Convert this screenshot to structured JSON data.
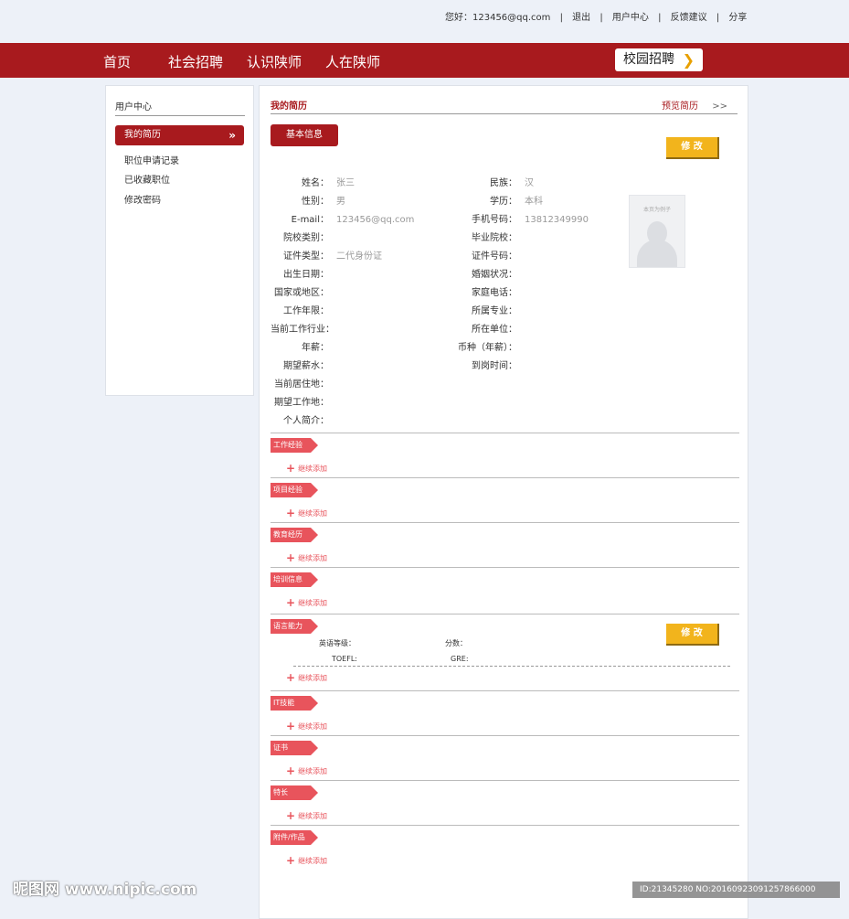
{
  "topbar": {
    "greeting": "您好：123456@qq.com",
    "links": [
      "退出",
      "用户中心",
      "反馈建议",
      "分享"
    ]
  },
  "nav": {
    "items": [
      "首页",
      "社会招聘",
      "认识陕师",
      "人在陕师"
    ],
    "campus": "校园招聘"
  },
  "sidebar": {
    "title": "用户中心",
    "active": "我的简历",
    "links": [
      "职位申请记录",
      "已收藏职位",
      "修改密码"
    ]
  },
  "main": {
    "title": "我的简历",
    "preview": "预览简历",
    "preview_arrow": ">>",
    "basic_info": "基本信息",
    "edit_label": "修 改",
    "photo_text": "本页为例子",
    "fields_left": [
      {
        "label": "姓名：",
        "value": "张三"
      },
      {
        "label": "性别：",
        "value": "男"
      },
      {
        "label": "E-mail：",
        "value": "123456@qq.com"
      },
      {
        "label": "院校类别：",
        "value": ""
      },
      {
        "label": "证件类型：",
        "value": "二代身份证"
      },
      {
        "label": "出生日期：",
        "value": ""
      },
      {
        "label": "国家或地区：",
        "value": ""
      },
      {
        "label": "工作年限：",
        "value": ""
      },
      {
        "label": "当前工作行业：",
        "value": ""
      },
      {
        "label": "年薪：",
        "value": ""
      },
      {
        "label": "期望薪水：",
        "value": ""
      },
      {
        "label": "当前居住地：",
        "value": ""
      },
      {
        "label": "期望工作地：",
        "value": ""
      },
      {
        "label": "个人简介：",
        "value": ""
      }
    ],
    "fields_right": [
      {
        "label": "民族：",
        "value": "汉"
      },
      {
        "label": "学历：",
        "value": "本科"
      },
      {
        "label": "手机号码：",
        "value": "13812349990"
      },
      {
        "label": "毕业院校：",
        "value": ""
      },
      {
        "label": "证件号码：",
        "value": ""
      },
      {
        "label": "婚姻状况：",
        "value": ""
      },
      {
        "label": "家庭电话：",
        "value": ""
      },
      {
        "label": "所属专业：",
        "value": ""
      },
      {
        "label": "所在单位：",
        "value": ""
      },
      {
        "label": "币种（年薪）：",
        "value": ""
      },
      {
        "label": "到岗时间：",
        "value": ""
      }
    ],
    "add_label": "继续添加",
    "sections": [
      "工作经验",
      "项目经验",
      "教育经历",
      "培训信息",
      "语言能力",
      "IT技能",
      "证书",
      "特长",
      "附件/作品"
    ],
    "language": {
      "english_level": "英语等级：",
      "score": "分数：",
      "toefl": "TOEFL:",
      "gre": "GRE:"
    }
  },
  "watermark": {
    "left": "昵图网 www.nipic.com",
    "right": "ID:21345280 NO:20160923091257866000"
  },
  "colors": {
    "brand_red": "#a81a1e",
    "tag_red": "#e8545c",
    "edit_yellow": "#f2b41c",
    "background": "#edf1f8"
  }
}
